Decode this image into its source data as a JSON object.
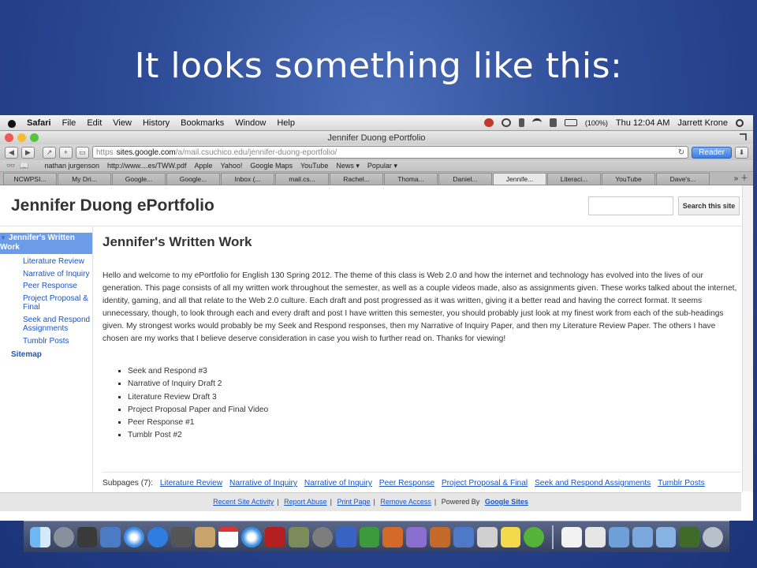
{
  "slide": {
    "title": "It looks something like this:"
  },
  "menubar": {
    "app": "Safari",
    "items": [
      "File",
      "Edit",
      "View",
      "History",
      "Bookmarks",
      "Window",
      "Help"
    ],
    "battery": "(100%)",
    "clock": "Thu 12:04 AM",
    "user": "Jarrett Krone"
  },
  "window": {
    "title": "Jennifer Duong ePortfolio"
  },
  "toolbar": {
    "url_scheme": "https",
    "url_domain": "sites.google.com",
    "url_path": "/a/mail.csuchico.edu/jennifer-duong-eportfolio/",
    "reader_label": "Reader"
  },
  "bookmarks": [
    "nathan jurgenson",
    "http://www....es/TWW.pdf",
    "Apple",
    "Yahoo!",
    "Google Maps",
    "YouTube",
    "News ▾",
    "Popular ▾"
  ],
  "tabs": [
    {
      "label": "NCWPSI...",
      "active": false
    },
    {
      "label": "My Dri...",
      "active": false
    },
    {
      "label": "Google...",
      "active": false
    },
    {
      "label": "Google...",
      "active": false
    },
    {
      "label": "Inbox (...",
      "active": false
    },
    {
      "label": "mail.cs...",
      "active": false
    },
    {
      "label": "Rachel...",
      "active": false
    },
    {
      "label": "Thoma...",
      "active": false
    },
    {
      "label": "Daniel...",
      "active": false
    },
    {
      "label": "Jennife...",
      "active": true
    },
    {
      "label": "Literaci...",
      "active": false
    },
    {
      "label": "YouTube",
      "active": false
    },
    {
      "label": "Dave's...",
      "active": false
    }
  ],
  "site": {
    "title": "Jennifer Duong ePortfolio",
    "search_button": "Search this site"
  },
  "sidebar": {
    "current": "Jennifer's Written Work",
    "items": [
      "Literature Review",
      "Narrative of Inquiry",
      "Peer Response",
      "Project Proposal & Final",
      "Seek and Respond Assignments",
      "Tumblr Posts"
    ],
    "sitemap": "Sitemap"
  },
  "main": {
    "heading": "Jennifer's Written Work",
    "intro": "Hello and welcome to my ePortfolio for English 130 Spring 2012. The theme of this class is Web 2.0 and how the internet and technology has evolved into the lives of our generation. This page consists of all my written work throughout the semester, as well as a couple videos made, also as assignments given. These works talked about the internet, identity, gaming, and all that relate to the Web 2.0 culture. Each draft and post progressed as it was written, giving it a better read and having the correct format. It seems unnecessary, though, to look through each and every draft and post I have written this semester, you should probably just look at my finest work from each of the sub-headings given. My strongest works would probably be my Seek and Respond responses, then my Narrative of Inquiry Paper, and then my Literature Review Paper. The others I have chosen are my works that I believe deserve consideration in case you wish to further read on. Thanks for viewing!",
    "list": [
      "Seek and Respond #3",
      "Narrative of Inquiry Draft 2",
      "Literature Review Draft 3",
      "Project Proposal Paper and Final Video",
      "Peer Response #1",
      "Tumblr Post #2"
    ]
  },
  "subpages": {
    "label": "Subpages (7):",
    "links": [
      "Literature Review",
      "Narrative of Inquiry",
      "Narrative of Inquiry",
      "Peer Response",
      "Project Proposal & Final",
      "Seek and Respond Assignments",
      "Tumblr Posts"
    ]
  },
  "footer": {
    "links": [
      "Recent Site Activity",
      "Report Abuse",
      "Print Page",
      "Remove Access"
    ],
    "powered": "Powered By",
    "brand": "Google Sites"
  },
  "colors": {
    "slide_bg": "#2c4a96",
    "link": "#1a55c6",
    "sidebar_highlight": "#6c9be7"
  }
}
